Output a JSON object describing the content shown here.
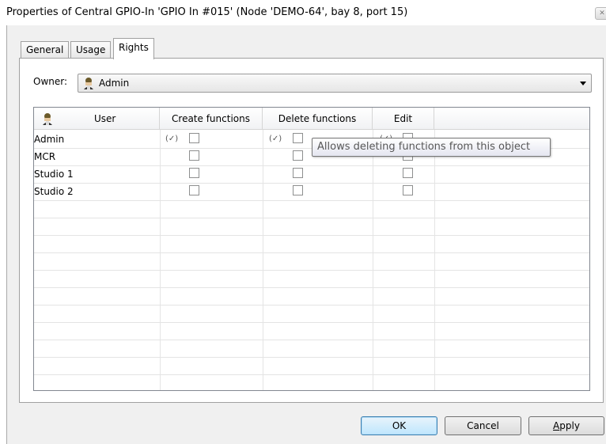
{
  "window": {
    "title": "Properties of Central GPIO-In 'GPIO In #015' (Node 'DEMO-64', bay  8, port 15)",
    "close_icon": "close-icon"
  },
  "tabs": [
    {
      "label": "General",
      "active": false
    },
    {
      "label": "Usage",
      "active": false
    },
    {
      "label": "Rights",
      "active": true
    }
  ],
  "owner": {
    "label": "Owner:",
    "value": "Admin",
    "icon": "user-icon"
  },
  "grid": {
    "columns": [
      "User",
      "Create functions",
      "Delete functions",
      "Edit"
    ],
    "header_icon": "user-icon",
    "rows": [
      {
        "user": "Admin",
        "create": false,
        "delete": false,
        "edit": false,
        "create_marker": "(✓)",
        "delete_marker": "(✓)",
        "edit_marker": "(✓)"
      },
      {
        "user": "MCR",
        "create": false,
        "delete": false,
        "edit": false
      },
      {
        "user": "Studio 1",
        "create": false,
        "delete": false,
        "edit": false
      },
      {
        "user": "Studio 2",
        "create": false,
        "delete": false,
        "edit": false
      }
    ]
  },
  "tooltip": "Allows deleting functions from this object",
  "buttons": {
    "ok": "OK",
    "cancel": "Cancel",
    "apply_prefix": "A",
    "apply_rest": "pply"
  },
  "colors": {
    "accent": "#3c7fb1",
    "panel": "#f0f0f0"
  }
}
